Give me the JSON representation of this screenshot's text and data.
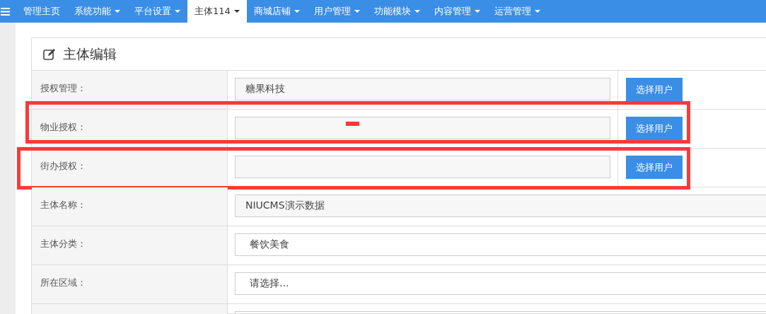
{
  "nav": {
    "items": [
      {
        "label": "管理主页",
        "dropdown": false,
        "selected": false
      },
      {
        "label": "系统功能",
        "dropdown": true,
        "selected": false
      },
      {
        "label": "平台设置",
        "dropdown": true,
        "selected": false
      },
      {
        "label": "主体114",
        "dropdown": true,
        "selected": true
      },
      {
        "label": "商城店铺",
        "dropdown": true,
        "selected": false
      },
      {
        "label": "用户管理",
        "dropdown": true,
        "selected": false
      },
      {
        "label": "功能模块",
        "dropdown": true,
        "selected": false
      },
      {
        "label": "内容管理",
        "dropdown": true,
        "selected": false
      },
      {
        "label": "运营管理",
        "dropdown": true,
        "selected": false
      }
    ]
  },
  "panel": {
    "title": "主体编辑",
    "rows": [
      {
        "kind": "picker",
        "label": "授权管理：",
        "value": "糖果科技",
        "button": "选择用户",
        "highlighted": false
      },
      {
        "kind": "picker",
        "label": "物业授权：",
        "button": "选择用户",
        "highlighted": true
      },
      {
        "kind": "picker",
        "label": "街办授权：",
        "button": "选择用户",
        "highlighted": true
      },
      {
        "kind": "text",
        "label": "主体名称：",
        "value": "NIUCMS演示数据",
        "highlighted": false
      },
      {
        "kind": "select",
        "label": "主体分类：",
        "value": "餐饮美食",
        "highlighted": false
      },
      {
        "kind": "select",
        "label": "所在区域：",
        "value": "请选择...",
        "highlighted": false
      },
      {
        "kind": "blank",
        "highlighted": false
      }
    ]
  }
}
